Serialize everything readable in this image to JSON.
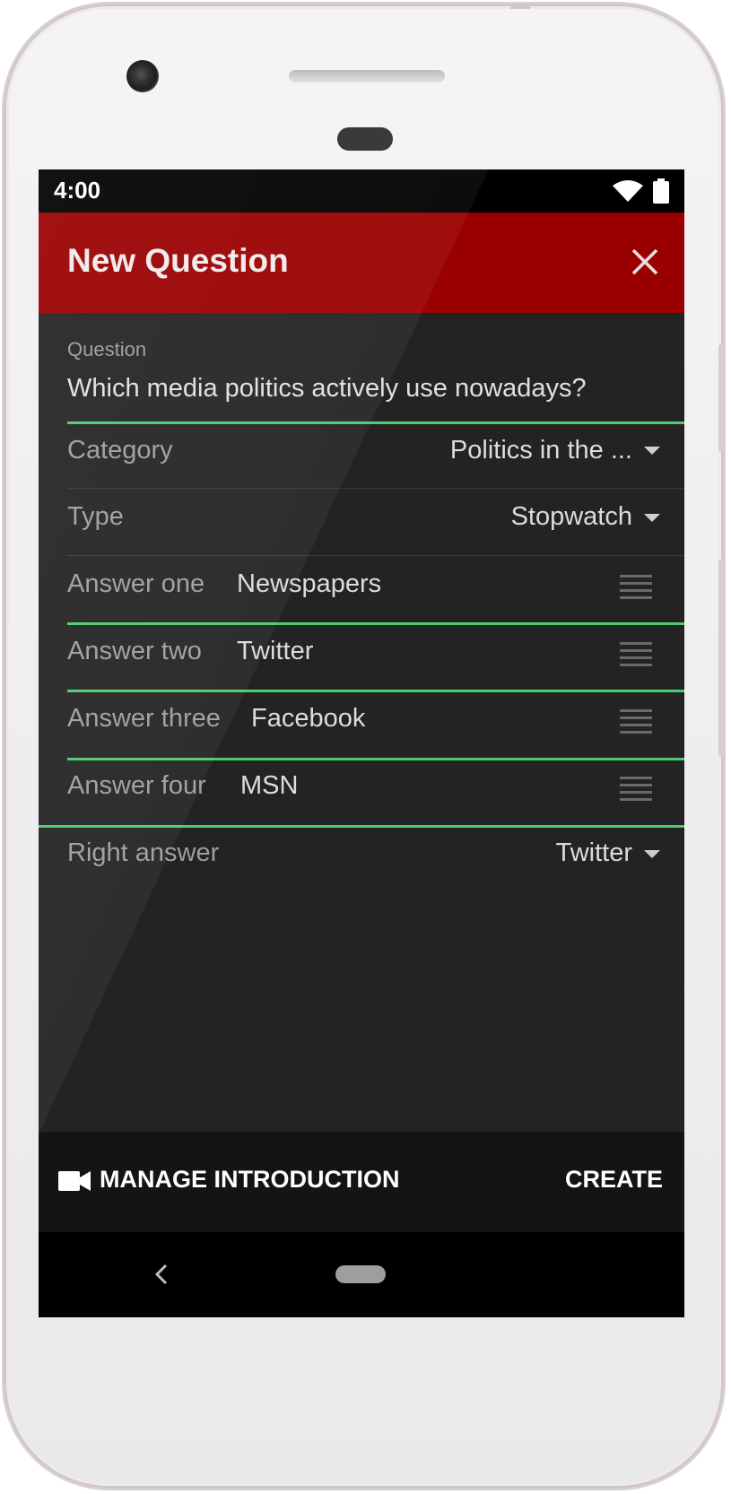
{
  "status_bar": {
    "time": "4:00"
  },
  "app_bar": {
    "title": "New Question"
  },
  "form": {
    "question": {
      "label": "Question",
      "value": "Which media politics actively use nowadays?"
    },
    "category": {
      "label": "Category",
      "value": "Politics in the ..."
    },
    "type": {
      "label": "Type",
      "value": "Stopwatch"
    },
    "answers": [
      {
        "label": "Answer one",
        "value": "Newspapers"
      },
      {
        "label": "Answer two",
        "value": "Twitter"
      },
      {
        "label": "Answer three",
        "value": "Facebook"
      },
      {
        "label": "Answer four",
        "value": "MSN"
      }
    ],
    "right_answer": {
      "label": "Right answer",
      "value": "Twitter"
    }
  },
  "bottom_bar": {
    "manage_label": "MANAGE INTRODUCTION",
    "create_label": "CREATE"
  },
  "colors": {
    "app_bar": "#9a0000",
    "accent": "#4ecb6c",
    "background": "#232323"
  },
  "icons": [
    "close-icon",
    "chevron-down-icon",
    "drag-handle-icon",
    "video-camera-icon",
    "back-icon",
    "home-icon",
    "wifi-icon",
    "battery-icon"
  ]
}
